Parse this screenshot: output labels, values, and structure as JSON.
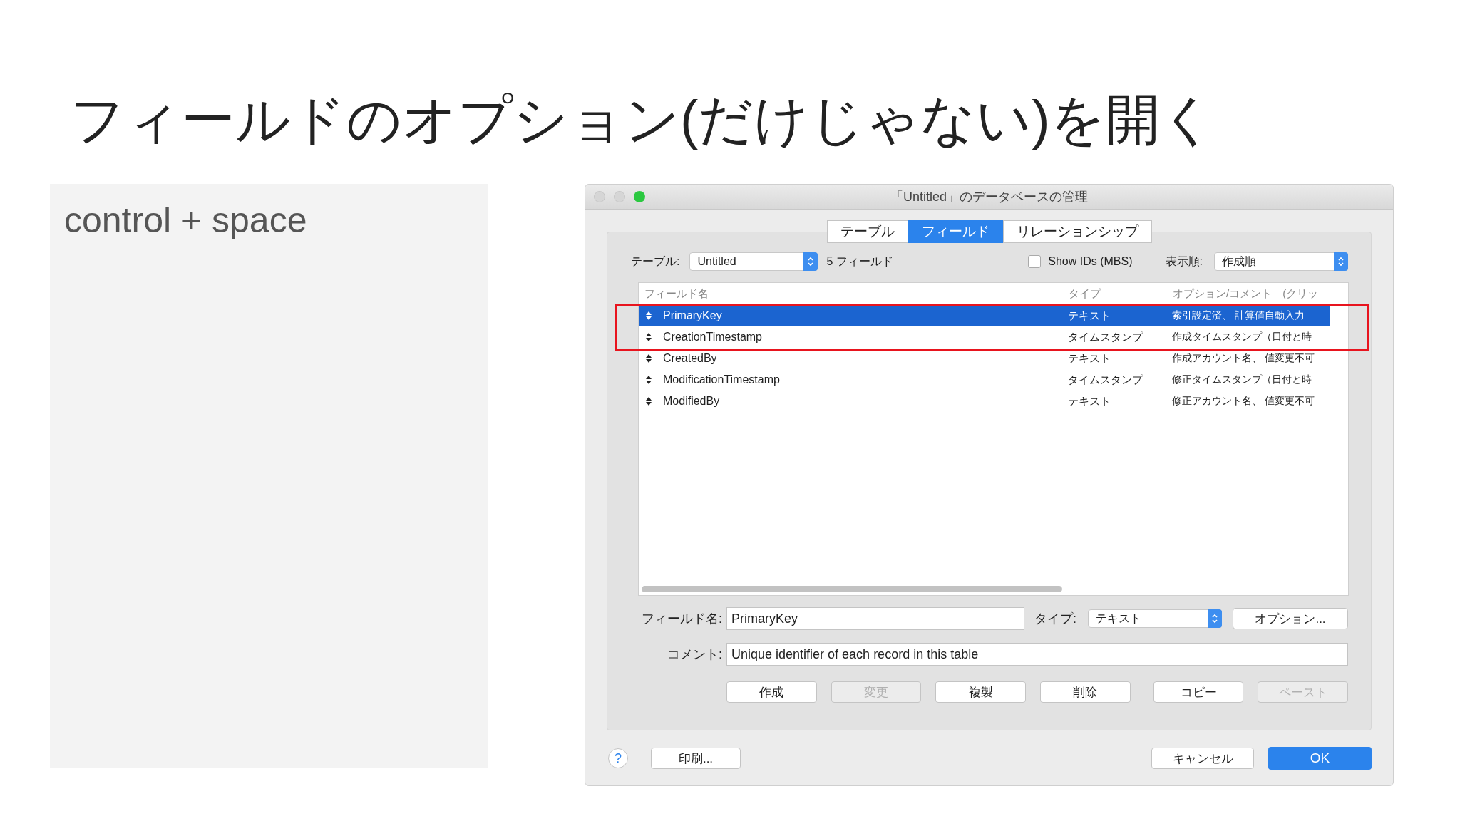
{
  "slide_title": "フィールドのオプション(だけじゃない)を開く",
  "note": {
    "text": "control + space"
  },
  "window": {
    "title": "「Untitled」のデータベースの管理",
    "tabs": [
      {
        "label": "テーブル",
        "selected": false
      },
      {
        "label": "フィールド",
        "selected": true
      },
      {
        "label": "リレーションシップ",
        "selected": false
      }
    ],
    "table_label": "テーブル:",
    "table_select": "Untitled",
    "field_count": "5 フィールド",
    "show_ids": {
      "label": "Show IDs (MBS)",
      "checked": false
    },
    "sort_label": "表示順:",
    "sort_select": "作成順",
    "columns": [
      "フィールド名",
      "タイプ",
      "オプション/コメント　(クリッ"
    ],
    "rows": [
      {
        "name": "PrimaryKey",
        "type": "テキスト",
        "options": "索引設定済、 計算値自動入力",
        "selected": true
      },
      {
        "name": "CreationTimestamp",
        "type": "タイムスタンプ",
        "options": "作成タイムスタンプ（日付と時",
        "selected": false
      },
      {
        "name": "CreatedBy",
        "type": "テキスト",
        "options": "作成アカウント名、 値変更不可",
        "selected": false
      },
      {
        "name": "ModificationTimestamp",
        "type": "タイムスタンプ",
        "options": "修正タイムスタンプ（日付と時",
        "selected": false
      },
      {
        "name": "ModifiedBy",
        "type": "テキスト",
        "options": "修正アカウント名、 値変更不可",
        "selected": false
      }
    ],
    "field_name_label": "フィールド名:",
    "field_name": "PrimaryKey",
    "type_label": "タイプ:",
    "type_select": "テキスト",
    "options_button": "オプション...",
    "comment_label": "コメント:",
    "comment": "Unique identifier of each record in this table",
    "actions": [
      {
        "label": "作成",
        "disabled": false
      },
      {
        "label": "変更",
        "disabled": true
      },
      {
        "label": "複製",
        "disabled": false
      },
      {
        "label": "削除",
        "disabled": false
      },
      {
        "label": "コピー",
        "disabled": false
      },
      {
        "label": "ペースト",
        "disabled": true
      }
    ],
    "help": "?",
    "print_button": "印刷...",
    "cancel_button": "キャンセル",
    "ok_button": "OK"
  }
}
